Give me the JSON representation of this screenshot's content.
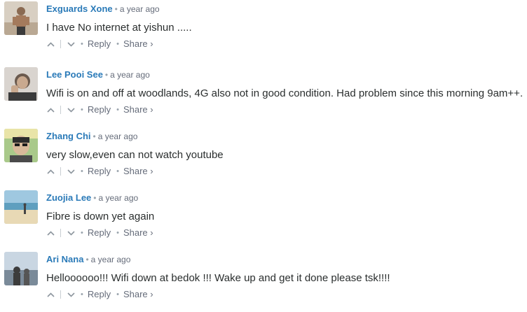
{
  "comments": [
    {
      "author": "Exguards Xone",
      "time": "a year ago",
      "text": "I have No internet at yishun .....",
      "reply_label": "Reply",
      "share_label": "Share ›"
    },
    {
      "author": "Lee Pooi See",
      "time": "a year ago",
      "text": "Wifi is on and off at woodlands, 4G also not in good condition. Had problem since this morning 9am++.",
      "reply_label": "Reply",
      "share_label": "Share ›"
    },
    {
      "author": "Zhang Chi",
      "time": "a year ago",
      "text": "very slow,even can not watch youtube",
      "reply_label": "Reply",
      "share_label": "Share ›"
    },
    {
      "author": "Zuojia Lee",
      "time": "a year ago",
      "text": "Fibre is down yet again",
      "reply_label": "Reply",
      "share_label": "Share ›"
    },
    {
      "author": "Ari Nana",
      "time": "a year ago",
      "text": "Helloooooo!!! Wifi down at bedok !!! Wake up and get it done please tsk!!!!",
      "reply_label": "Reply",
      "share_label": "Share ›"
    }
  ],
  "colors": {
    "author": "#2a7ab8",
    "meta": "#656c7a",
    "body_text": "#2a2e2e"
  },
  "icons": {
    "upvote": "chevron-up-icon",
    "downvote": "chevron-down-icon"
  }
}
